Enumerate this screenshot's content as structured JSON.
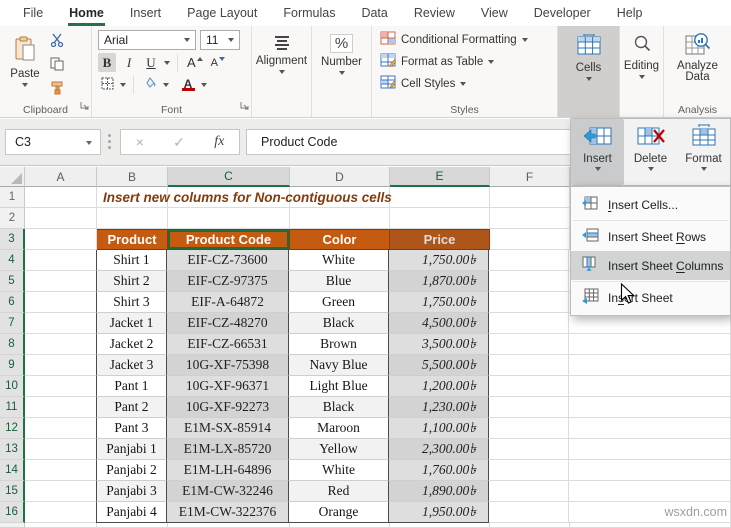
{
  "colors": {
    "excel_green": "#217346",
    "table_header_orange": "#C55A11",
    "title_text": "#843C0C",
    "selection_overlay": "rgba(70,70,70,0.18)",
    "font_color_red": "#C00000"
  },
  "icons": {
    "cancel": "×",
    "enter": "✓",
    "percent": "%"
  },
  "ribbon": {
    "tabs": [
      {
        "label": "File"
      },
      {
        "label": "Home"
      },
      {
        "label": "Insert"
      },
      {
        "label": "Page Layout"
      },
      {
        "label": "Formulas"
      },
      {
        "label": "Data"
      },
      {
        "label": "Review"
      },
      {
        "label": "View"
      },
      {
        "label": "Developer"
      },
      {
        "label": "Help"
      }
    ],
    "clipboard": {
      "paste": "Paste",
      "group_label": "Clipboard"
    },
    "font": {
      "font_name": "Arial",
      "font_size": "11",
      "bold": "B",
      "italic": "I",
      "underline": "U",
      "grow": "A",
      "shrink": "A",
      "color_a": "A",
      "group_label": "Font"
    },
    "alignment": {
      "label": "Alignment"
    },
    "number": {
      "label": "Number"
    },
    "styles": {
      "conditional_formatting": "Conditional Formatting",
      "format_as_table": "Format as Table",
      "cell_styles": "Cell Styles",
      "group_label": "Styles"
    },
    "cells": {
      "label": "Cells"
    },
    "editing": {
      "label": "Editing"
    },
    "analysis": {
      "analyze_line1": "Analyze",
      "analyze_line2": "Data",
      "group_label": "Analysis"
    }
  },
  "formula_bar": {
    "name_box": "C3",
    "fx_label": "fx",
    "content": "Product Code"
  },
  "cells_dropdown": {
    "buttons": [
      {
        "label": "Insert"
      },
      {
        "label": "Delete"
      },
      {
        "label": "Format"
      }
    ],
    "menu_items": [
      {
        "pre": "",
        "accel": "I",
        "post": "nsert Cells..."
      },
      {
        "pre": "Insert Sheet ",
        "accel": "R",
        "post": "ows"
      },
      {
        "pre": "Insert Sheet ",
        "accel": "C",
        "post": "olumns"
      },
      {
        "pre": "In",
        "accel": "s",
        "post": "ert Sheet"
      }
    ]
  },
  "sheet": {
    "title_note": "Insert new columns for Non-contiguous cells",
    "col_letters": [
      "A",
      "B",
      "C",
      "D",
      "E",
      "F"
    ],
    "pre_rows": [
      {
        "n": "1"
      },
      {
        "n": "2"
      }
    ],
    "header_row": {
      "n": "3",
      "product": "Product",
      "code": "Product Code",
      "color": "Color",
      "price": "Price"
    },
    "rows": [
      {
        "n": "4",
        "product": "Shirt 1",
        "code": "EIF-CZ-73600",
        "color": "White",
        "price": "1,750.00৳"
      },
      {
        "n": "5",
        "product": "Shirt 2",
        "code": "EIF-CZ-97375",
        "color": "Blue",
        "price": "1,870.00৳"
      },
      {
        "n": "6",
        "product": "Shirt 3",
        "code": "EIF-A-64872",
        "color": "Green",
        "price": "1,750.00৳"
      },
      {
        "n": "7",
        "product": "Jacket 1",
        "code": "EIF-CZ-48270",
        "color": "Black",
        "price": "4,500.00৳"
      },
      {
        "n": "8",
        "product": "Jacket 2",
        "code": "EIF-CZ-66531",
        "color": "Brown",
        "price": "3,500.00৳"
      },
      {
        "n": "9",
        "product": "Jacket 3",
        "code": "10G-XF-75398",
        "color": "Navy Blue",
        "price": "5,500.00৳"
      },
      {
        "n": "10",
        "product": "Pant 1",
        "code": "10G-XF-96371",
        "color": "Light Blue",
        "price": "1,200.00৳"
      },
      {
        "n": "11",
        "product": "Pant 2",
        "code": "10G-XF-92273",
        "color": "Black",
        "price": "1,230.00৳"
      },
      {
        "n": "12",
        "product": "Pant 3",
        "code": "E1M-SX-85914",
        "color": "Maroon",
        "price": "1,100.00৳"
      },
      {
        "n": "13",
        "product": "Panjabi 1",
        "code": "E1M-LX-85720",
        "color": "Yellow",
        "price": "2,300.00৳"
      },
      {
        "n": "14",
        "product": "Panjabi 2",
        "code": "E1M-LH-64896",
        "color": "White",
        "price": "1,760.00৳"
      },
      {
        "n": "15",
        "product": "Panjabi 3",
        "code": "E1M-CW-32246",
        "color": "Red",
        "price": "1,890.00৳"
      },
      {
        "n": "16",
        "product": "Panjabi 4",
        "code": "E1M-CW-322376",
        "color": "Orange",
        "price": "1,950.00৳"
      }
    ]
  },
  "watermark": "wsxdn.com"
}
